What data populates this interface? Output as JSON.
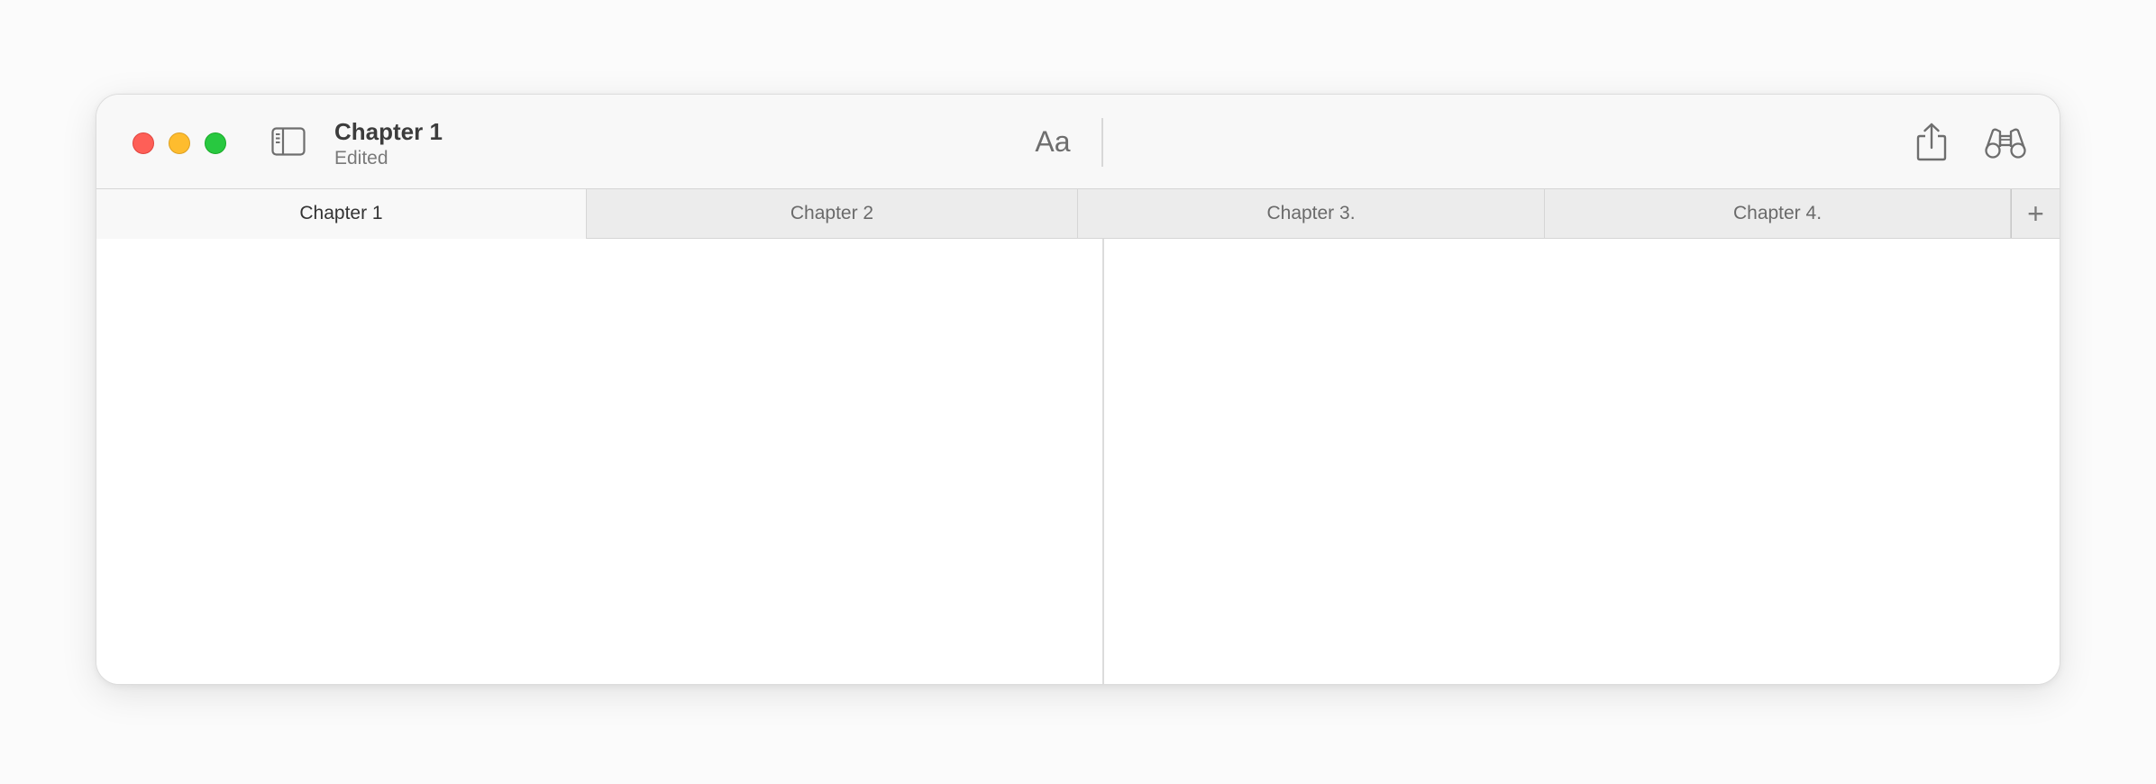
{
  "window": {
    "title": "Chapter 1",
    "subtitle": "Edited"
  },
  "toolbar": {
    "font_label": "Aa",
    "icons": {
      "sidebar": "sidebar-icon",
      "share": "share-icon",
      "find": "binoculars-icon"
    }
  },
  "tabs": [
    {
      "label": "Chapter 1",
      "active": true
    },
    {
      "label": "Chapter 2",
      "active": false
    },
    {
      "label": "Chapter 3.",
      "active": false
    },
    {
      "label": "Chapter 4.",
      "active": false
    }
  ],
  "new_tab_label": "+",
  "colors": {
    "close": "#fe5f57",
    "minimize": "#febc2e",
    "maximize": "#28c840"
  }
}
